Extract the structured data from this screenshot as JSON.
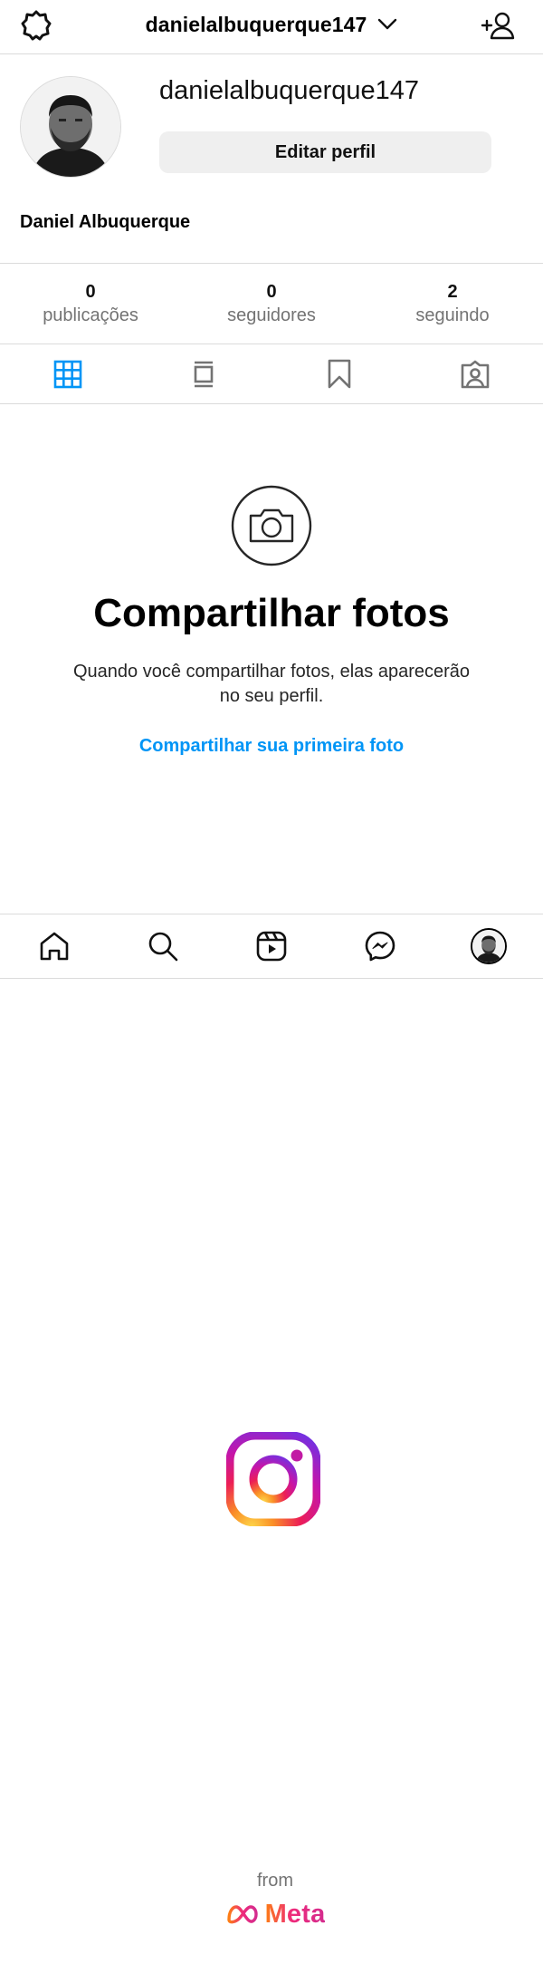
{
  "header": {
    "account_name": "danielalbuquerque147",
    "icons": [
      "settings-icon",
      "chevron-down-icon",
      "add-person-icon"
    ]
  },
  "profile": {
    "username": "danielalbuquerque147",
    "edit_button": "Editar perfil",
    "full_name": "Daniel Albuquerque"
  },
  "stats": [
    {
      "value": "0",
      "label": "publicações"
    },
    {
      "value": "0",
      "label": "seguidores"
    },
    {
      "value": "2",
      "label": "seguindo"
    }
  ],
  "tabs": [
    {
      "icon": "grid-icon",
      "active": true
    },
    {
      "icon": "feed-icon",
      "active": false
    },
    {
      "icon": "saved-icon",
      "active": false
    },
    {
      "icon": "tagged-icon",
      "active": false
    }
  ],
  "empty_state": {
    "title": "Compartilhar fotos",
    "text": "Quando você compartilhar fotos, elas aparecerão no seu perfil.",
    "link": "Compartilhar sua primeira foto"
  },
  "bottom_nav": [
    "home-icon",
    "search-icon",
    "reels-icon",
    "messenger-icon",
    "profile-avatar"
  ],
  "splash": {
    "from": "from",
    "brand": "Meta"
  },
  "colors": {
    "accent": "#0095f6",
    "border": "#dbdbdb",
    "secondary_text": "#737373",
    "button_bg": "#efefef"
  }
}
